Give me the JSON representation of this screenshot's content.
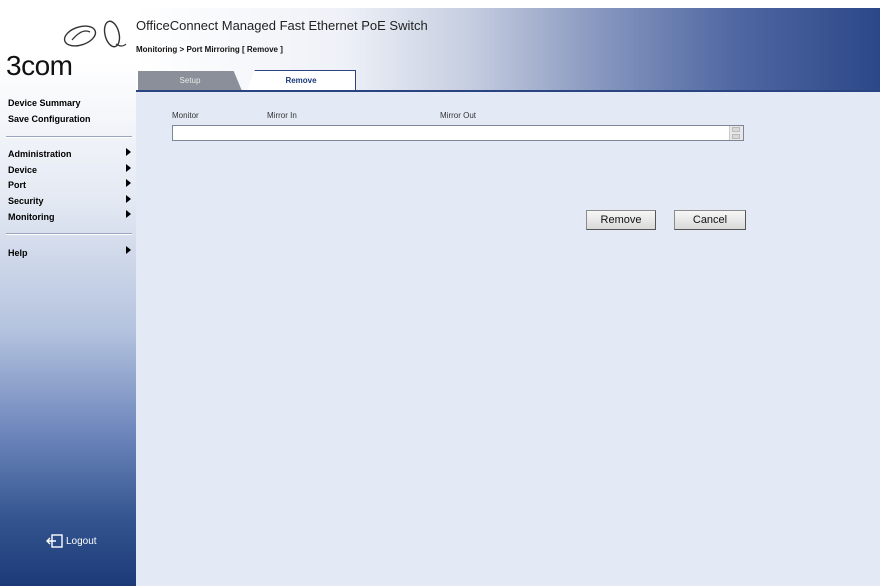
{
  "brand": {
    "name": "3com"
  },
  "sidebar": {
    "top_links": [
      "Device Summary",
      "Save Configuration"
    ],
    "menu": [
      {
        "label": "Administration"
      },
      {
        "label": "Device"
      },
      {
        "label": "Port"
      },
      {
        "label": "Security"
      },
      {
        "label": "Monitoring"
      }
    ],
    "help": "Help",
    "logout": "Logout"
  },
  "header": {
    "title": "OfficeConnect Managed Fast Ethernet PoE Switch",
    "breadcrumb": "Monitoring > Port Mirroring [ Remove ]",
    "tabs": [
      {
        "label": "Setup",
        "active": false
      },
      {
        "label": "Remove",
        "active": true
      }
    ]
  },
  "main": {
    "columns": [
      "Monitor",
      "Mirror In",
      "Mirror Out"
    ],
    "rows": [],
    "buttons": {
      "remove": "Remove",
      "cancel": "Cancel"
    }
  },
  "colors": {
    "header_dark": "#2c4788",
    "content_bg": "#e3e9f5",
    "sidebar_dark": "#1c3a78"
  }
}
